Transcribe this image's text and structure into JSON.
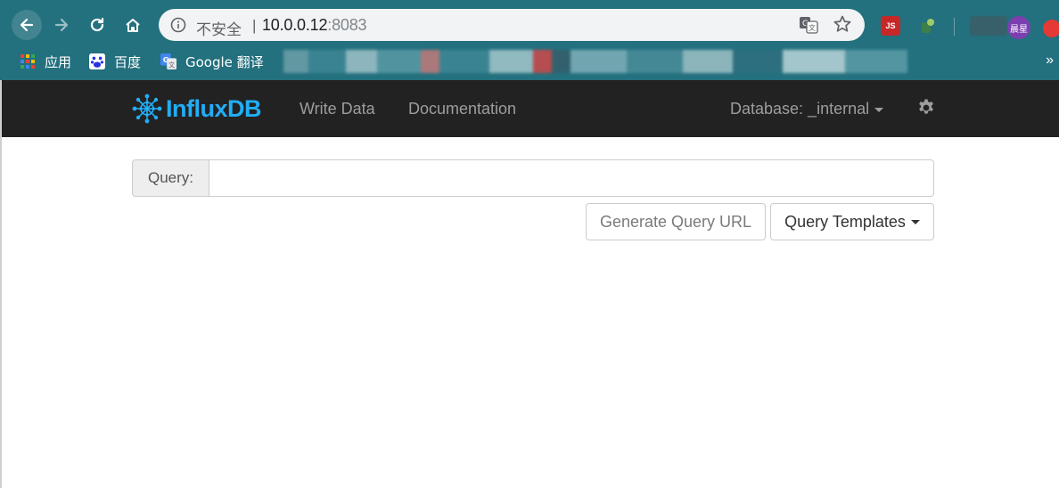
{
  "browser": {
    "security_label": "不安全",
    "separator": "|",
    "url_host": "10.0.0.12",
    "url_port": ":8083",
    "extensions": {
      "js_label": "JS",
      "avatar_label": "晨星"
    },
    "bookmarks": [
      {
        "label": "应用",
        "icon": "apps-grid-icon"
      },
      {
        "label": "百度",
        "icon": "baidu-paw-icon"
      },
      {
        "label": "Google 翻译",
        "icon": "google-translate-icon"
      }
    ],
    "more": "»"
  },
  "app": {
    "brand": "InfluxDB",
    "nav": {
      "write_data": "Write Data",
      "documentation": "Documentation",
      "database_label": "Database: _internal"
    },
    "query": {
      "addon_label": "Query:",
      "input_value": "",
      "input_placeholder": ""
    },
    "buttons": {
      "generate_url": "Generate Query URL",
      "templates": "Query Templates"
    },
    "colors": {
      "navbar_bg": "#222222",
      "brand_blue": "#22adf6",
      "chrome_bg": "#23707e"
    }
  }
}
